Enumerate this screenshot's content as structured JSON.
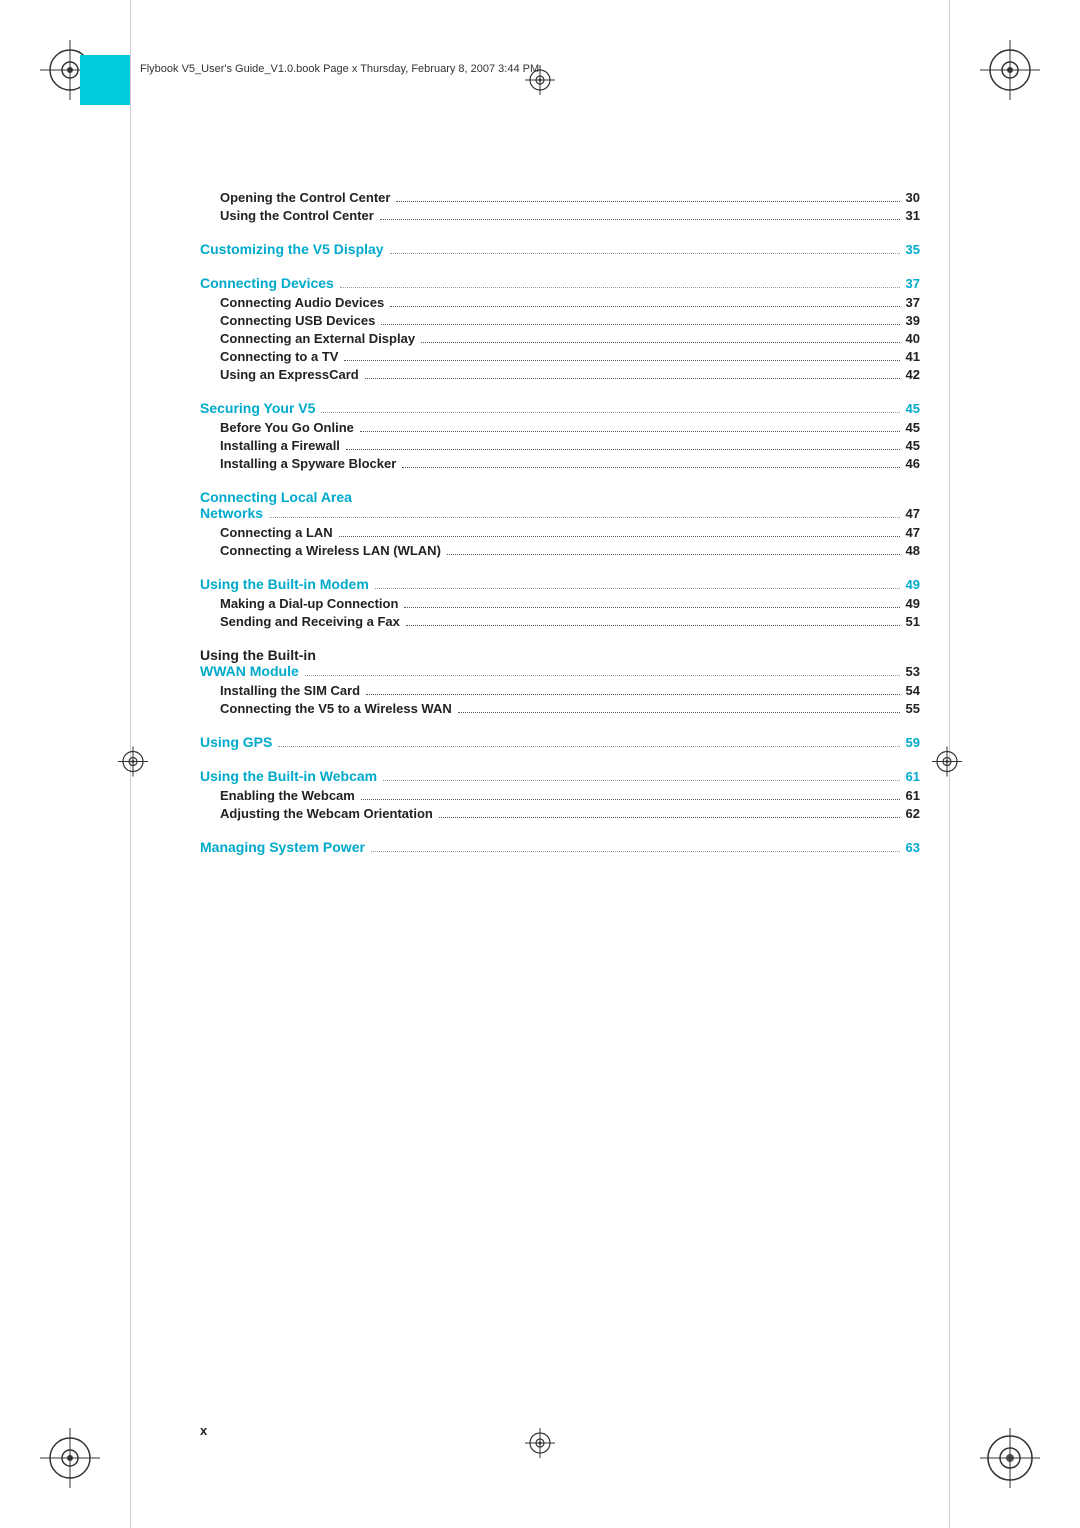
{
  "header": {
    "file_info": "Flybook V5_User's Guide_V1.0.book  Page x  Thursday, February 8, 2007  3:44 PM"
  },
  "toc": {
    "entries": [
      {
        "label": "Opening the Control Center",
        "page": "30",
        "type": "sub"
      },
      {
        "label": "Using the Control Center",
        "page": "31",
        "type": "sub"
      },
      {
        "label": "Customizing the V5 Display",
        "page": "35",
        "type": "section"
      },
      {
        "label": "Connecting Devices",
        "page": "37",
        "type": "section"
      },
      {
        "label": "Connecting Audio Devices",
        "page": "37",
        "type": "sub"
      },
      {
        "label": "Connecting USB Devices",
        "page": "39",
        "type": "sub"
      },
      {
        "label": "Connecting an External Display",
        "page": "40",
        "type": "sub"
      },
      {
        "label": "Connecting to a TV",
        "page": "41",
        "type": "sub"
      },
      {
        "label": "Using an ExpressCard",
        "page": "42",
        "type": "sub"
      },
      {
        "label": "Securing Your V5",
        "page": "45",
        "type": "section"
      },
      {
        "label": "Before You Go Online",
        "page": "45",
        "type": "sub"
      },
      {
        "label": "Installing a Firewall",
        "page": "45",
        "type": "sub"
      },
      {
        "label": "Installing a Spyware Blocker",
        "page": "46",
        "type": "sub"
      },
      {
        "label": "Connecting Local Area Networks",
        "page": "47",
        "type": "section-multi",
        "line1": "Connecting Local Area",
        "line2": "Networks"
      },
      {
        "label": "Connecting a LAN",
        "page": "47",
        "type": "sub"
      },
      {
        "label": "Connecting a Wireless LAN (WLAN)",
        "page": "48",
        "type": "sub"
      },
      {
        "label": "Using the Built-in Modem",
        "page": "49",
        "type": "section"
      },
      {
        "label": "Making a Dial-up Connection",
        "page": "49",
        "type": "sub"
      },
      {
        "label": "Sending and Receiving a Fax",
        "page": "51",
        "type": "sub"
      },
      {
        "label": "Using the Built-in WWAN Module",
        "page": "53",
        "type": "section-multi-wwan",
        "line1": "Using the Built-in",
        "line2": "WWAN Module"
      },
      {
        "label": "Installing the SIM Card",
        "page": "54",
        "type": "sub"
      },
      {
        "label": "Connecting the V5 to a Wireless WAN",
        "page": "55",
        "type": "sub"
      },
      {
        "label": "Using GPS",
        "page": "59",
        "type": "section"
      },
      {
        "label": "Using the Built-in Webcam",
        "page": "61",
        "type": "section"
      },
      {
        "label": "Enabling the Webcam",
        "page": "61",
        "type": "sub"
      },
      {
        "label": "Adjusting the Webcam Orientation",
        "page": "62",
        "type": "sub"
      },
      {
        "label": "Managing System Power",
        "page": "63",
        "type": "section"
      }
    ]
  },
  "bottom_page": "x",
  "colors": {
    "cyan": "#00AACC",
    "cyan_square": "#00CCDD",
    "text": "#222222",
    "dots": "#555555"
  }
}
